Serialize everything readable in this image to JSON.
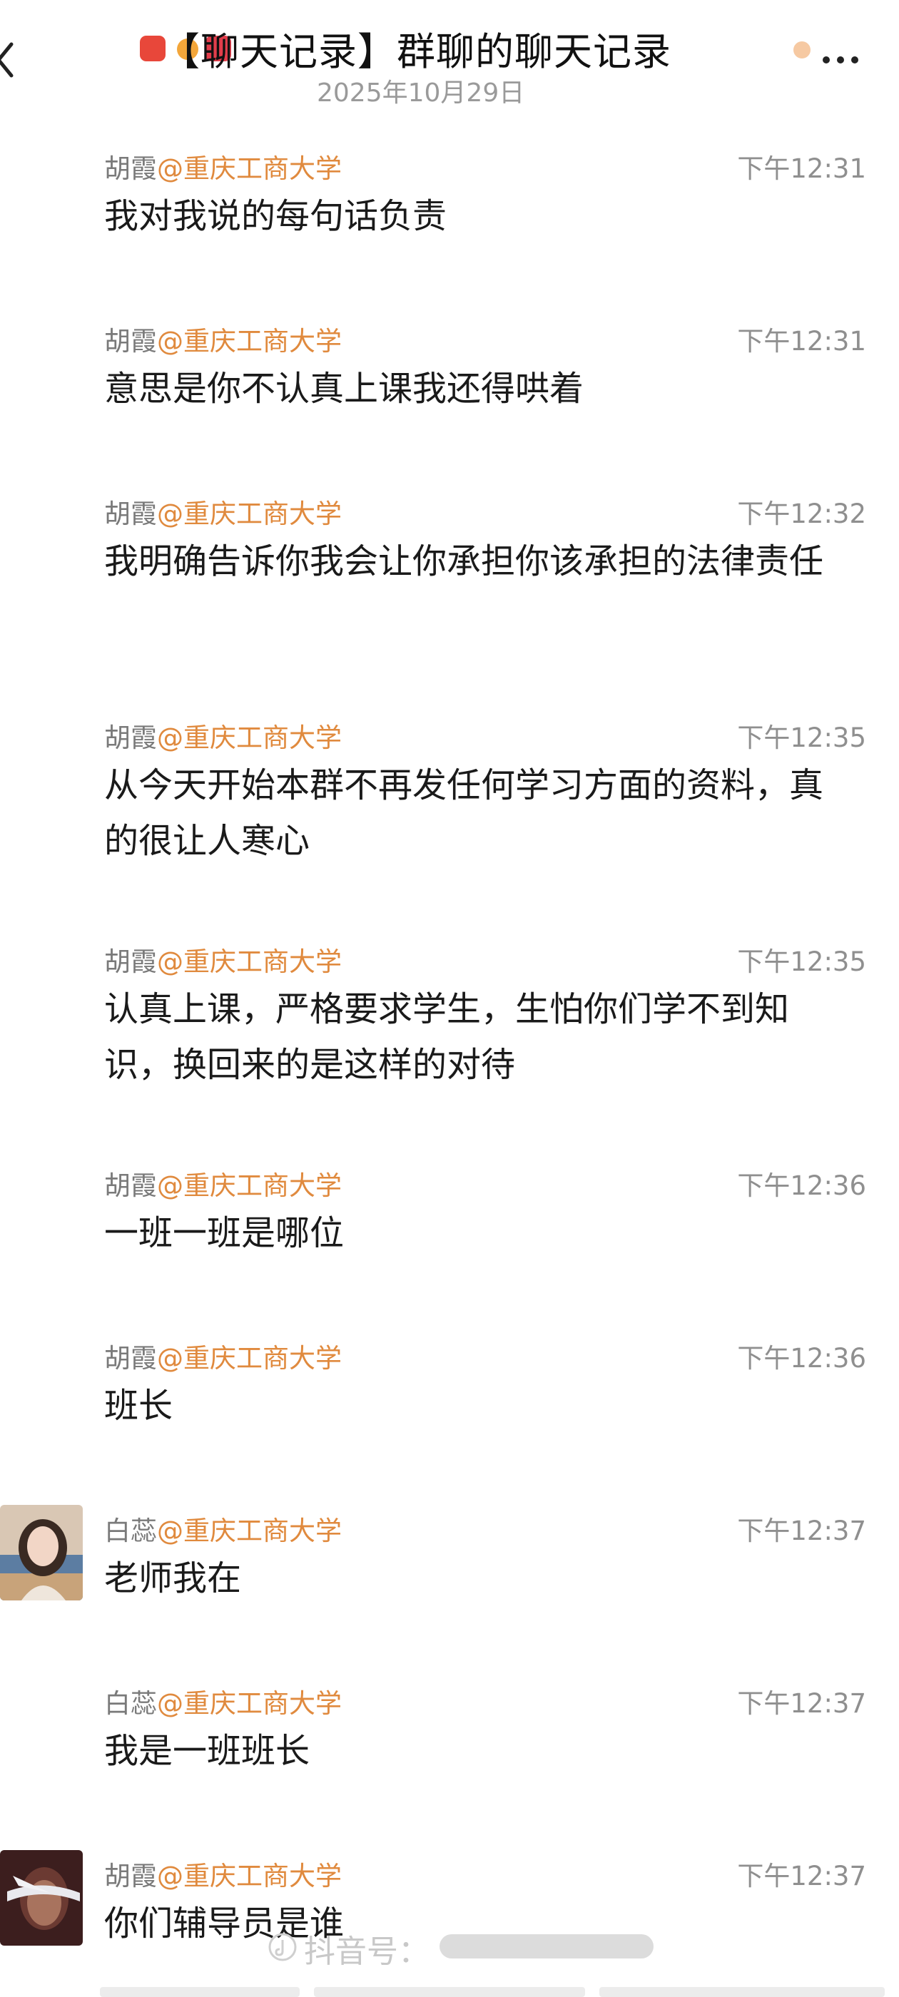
{
  "header": {
    "title": "【聊天记录】群聊的聊天记录",
    "date": "2025年10月29日"
  },
  "messages": [
    {
      "sender": "胡霞",
      "org": "@重庆工商大学",
      "time": "下午12:31",
      "text": "我对我说的每句话负责"
    },
    {
      "sender": "胡霞",
      "org": "@重庆工商大学",
      "time": "下午12:31",
      "text": "意思是你不认真上课我还得哄着"
    },
    {
      "sender": "胡霞",
      "org": "@重庆工商大学",
      "time": "下午12:32",
      "text": "我明确告诉你我会让你承担你该承担的法律责任"
    },
    {
      "sender": "胡霞",
      "org": "@重庆工商大学",
      "time": "下午12:35",
      "text": "从今天开始本群不再发任何学习方面的资料，真的很让人寒心"
    },
    {
      "sender": "胡霞",
      "org": "@重庆工商大学",
      "time": "下午12:35",
      "text": "认真上课，严格要求学生，生怕你们学不到知识，换回来的是这样的对待"
    },
    {
      "sender": "胡霞",
      "org": "@重庆工商大学",
      "time": "下午12:36",
      "text": "一班一班是哪位"
    },
    {
      "sender": "胡霞",
      "org": "@重庆工商大学",
      "time": "下午12:36",
      "text": "班长"
    },
    {
      "sender": "白蕊",
      "org": "@重庆工商大学",
      "time": "下午12:37",
      "text": "老师我在"
    },
    {
      "sender": "白蕊",
      "org": "@重庆工商大学",
      "time": "下午12:37",
      "text": "我是一班班长"
    },
    {
      "sender": "胡霞",
      "org": "@重庆工商大学",
      "time": "下午12:37",
      "text": "你们辅导员是谁"
    }
  ],
  "watermark": {
    "text": "抖音号："
  },
  "colors": {
    "org_accent": "#e08a3e",
    "sender_gray": "#7a7a7a",
    "time_gray": "#8f8f8f",
    "text": "#1a1a1a"
  },
  "icons": [
    "back-chevron-icon",
    "app-logo-icon",
    "more-dots-icon",
    "douyin-logo-icon"
  ]
}
